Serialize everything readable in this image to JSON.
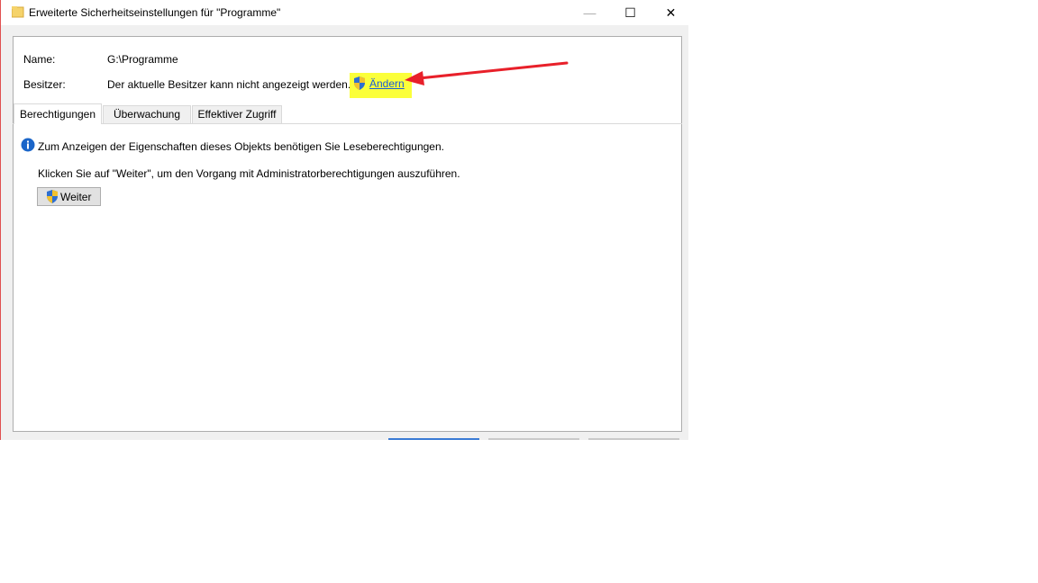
{
  "window": {
    "title": "Erweiterte Sicherheitseinstellungen für \"Programme\"",
    "controls": {
      "minimize": "—",
      "maximize": "☐",
      "close": "✕"
    }
  },
  "fields": {
    "name_label": "Name:",
    "name_value": "G:\\Programme",
    "owner_label": "Besitzer:",
    "owner_value": "Der aktuelle Besitzer kann nicht angezeigt werden.",
    "change_link": "Ändern"
  },
  "tabs": [
    {
      "label": "Berechtigungen",
      "active": true
    },
    {
      "label": "Überwachung",
      "active": false
    },
    {
      "label": "Effektiver Zugriff",
      "active": false
    }
  ],
  "content": {
    "info_text": "Zum Anzeigen der Eigenschaften dieses Objekts benötigen Sie Leseberechtigungen.",
    "hint_text": "Klicken Sie auf \"Weiter\", um den Vorgang mit Administratorberechtigungen auszuführen.",
    "continue_button": "Weiter"
  },
  "colors": {
    "highlight": "#fbff3a",
    "arrow": "#e8202a",
    "link": "#1a5bd8"
  },
  "icons": {
    "folder": "folder-icon",
    "uac_shield": "uac-shield-icon",
    "info": "info-icon"
  }
}
